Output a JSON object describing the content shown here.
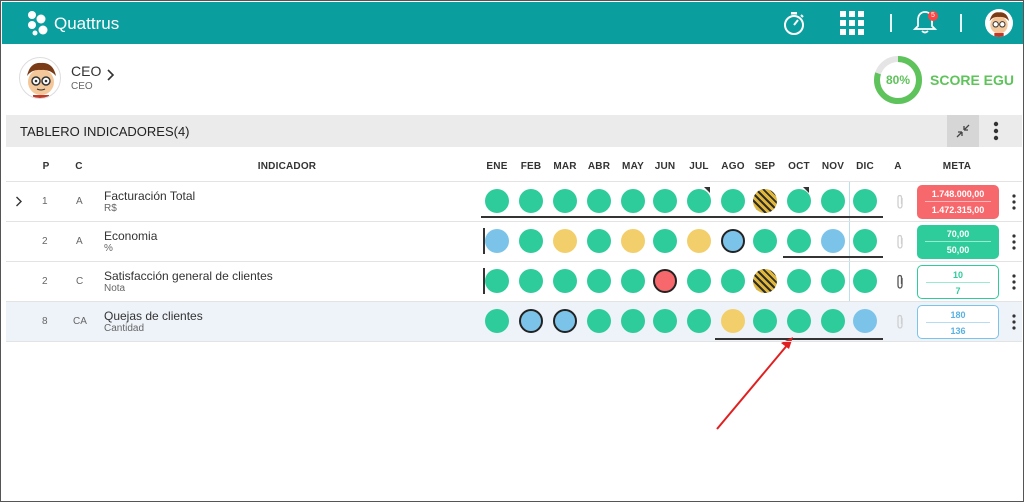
{
  "app": {
    "brand": "Quattrus",
    "notification_count": "5"
  },
  "colors": {
    "topbar": "#0b9e9e",
    "green": "#2ecc9a",
    "blue": "#7cc3ea",
    "yellow": "#f3cf6b",
    "red": "#f7686c",
    "score": "#5fc35b"
  },
  "icons": {
    "logo": "quattrus-logo-icon",
    "timer": "stopwatch-icon",
    "apps": "grid-icon",
    "notifications": "bell-icon",
    "user": "avatar",
    "expand": "chevron-right-icon",
    "collapse": "collapse-arrows-icon",
    "menu": "kebab-menu-icon",
    "attachment": "paperclip-icon"
  },
  "user": {
    "role": "CEO",
    "role_sub": "CEO"
  },
  "score": {
    "value": "80%",
    "fraction": 0.8,
    "label": "SCORE EGU"
  },
  "section": {
    "title": "TABLERO INDICADORES(4)"
  },
  "columns": {
    "p": "P",
    "c": "C",
    "indicator": "INDICADOR",
    "a": "A",
    "meta": "META",
    "months": [
      "ENE",
      "FEB",
      "MAR",
      "ABR",
      "MAY",
      "JUN",
      "JUL",
      "AGO",
      "SEP",
      "OCT",
      "NOV",
      "DIC"
    ]
  },
  "rows": [
    {
      "p": "1",
      "c": "A",
      "name": "Facturación Total",
      "unit": "R$",
      "expandable": true,
      "dots": [
        "green",
        "green",
        "green",
        "green",
        "green",
        "green",
        "green",
        "green",
        "striped",
        "green",
        "green",
        "green"
      ],
      "meta_style": "red",
      "meta_top": "1.748.000,00",
      "meta_bottom": "1.472.315,00",
      "attachment": "faded"
    },
    {
      "p": "2",
      "c": "A",
      "name": "Economia",
      "unit": "%",
      "expandable": false,
      "dots": [
        "blue",
        "green",
        "yellow",
        "green",
        "yellow",
        "green",
        "yellow",
        "blue-outline",
        "green",
        "green",
        "blue",
        "green"
      ],
      "meta_style": "green",
      "meta_top": "70,00",
      "meta_bottom": "50,00",
      "attachment": "faded"
    },
    {
      "p": "2",
      "c": "C",
      "name": "Satisfacción general de clientes",
      "unit": "Nota",
      "expandable": false,
      "dots": [
        "green",
        "green",
        "green",
        "green",
        "green",
        "red-outline",
        "green",
        "green",
        "striped",
        "green",
        "green",
        "green"
      ],
      "meta_style": "outline-green",
      "meta_top": "10",
      "meta_bottom": "7",
      "attachment": "visible"
    },
    {
      "p": "8",
      "c": "CA",
      "name": "Quejas de clientes",
      "unit": "Cantidad",
      "expandable": false,
      "dots": [
        "green",
        "blue-outline",
        "blue-outline",
        "green",
        "green",
        "green",
        "green",
        "yellow",
        "green",
        "green",
        "green",
        "blue"
      ],
      "meta_style": "outline-blue",
      "meta_top": "180",
      "meta_bottom": "136",
      "attachment": "faded"
    }
  ]
}
